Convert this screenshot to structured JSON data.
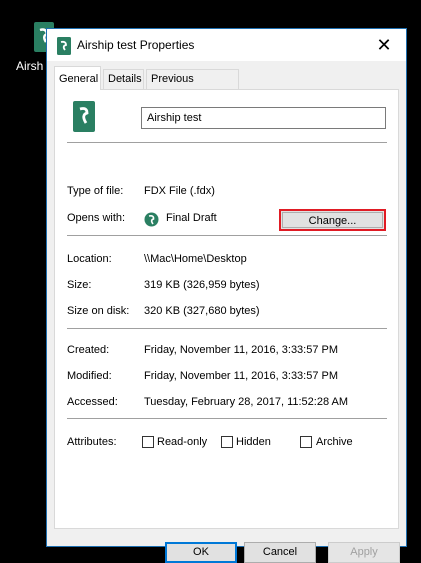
{
  "desktop": {
    "icon_label": "Airsh"
  },
  "window": {
    "title": "Airship test Properties",
    "close_glyph": "✕"
  },
  "tabs": [
    {
      "label": "General",
      "active": true
    },
    {
      "label": "Details",
      "active": false
    },
    {
      "label": "Previous Versions",
      "active": false
    }
  ],
  "general": {
    "file_name": "Airship test",
    "type_label": "Type of file:",
    "type_value": "FDX File (.fdx)",
    "opens_label": "Opens with:",
    "opens_value": "Final Draft",
    "change_label": "Change...",
    "location_label": "Location:",
    "location_value": "\\\\Mac\\Home\\Desktop",
    "size_label": "Size:",
    "size_value": "319 KB (326,959 bytes)",
    "size_disk_label": "Size on disk:",
    "size_disk_value": "320 KB (327,680 bytes)",
    "created_label": "Created:",
    "created_value": "Friday, November 11, 2016, 3:33:57 PM",
    "modified_label": "Modified:",
    "modified_value": "Friday, November 11, 2016, 3:33:57 PM",
    "accessed_label": "Accessed:",
    "accessed_value": "Tuesday, February 28, 2017, 11:52:28 AM",
    "attributes_label": "Attributes:",
    "readonly_label": "Read-only",
    "hidden_label": "Hidden",
    "archive_label": "Archive"
  },
  "buttons": {
    "ok": "OK",
    "cancel": "Cancel",
    "apply": "Apply"
  },
  "colors": {
    "accent": "#0078d7",
    "highlight": "#e01b24",
    "brand_green": "#2a7f62"
  }
}
